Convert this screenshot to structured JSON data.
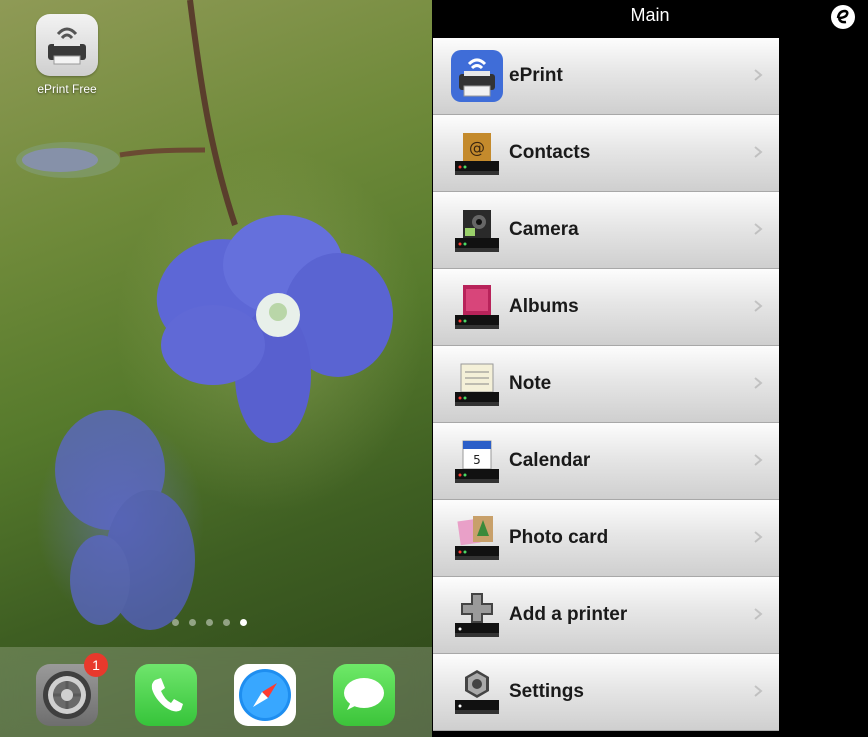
{
  "home_screen": {
    "app": {
      "label": "ePrint Free",
      "icon": "eprint-printer-icon"
    },
    "page_dots": {
      "count": 5,
      "active_index": 4
    },
    "dock": {
      "settings_badge": "1",
      "apps": [
        {
          "icon": "settings-gear-icon"
        },
        {
          "icon": "phone-icon"
        },
        {
          "icon": "safari-compass-icon"
        },
        {
          "icon": "messages-icon"
        }
      ]
    }
  },
  "eprint_app": {
    "nav": {
      "title": "Main",
      "logo_icon": "eprint-e-logo-icon"
    },
    "menu": [
      {
        "label": "ePrint",
        "icon": "eprint-wifi-printer-icon"
      },
      {
        "label": "Contacts",
        "icon": "contacts-printer-icon"
      },
      {
        "label": "Camera",
        "icon": "camera-printer-icon"
      },
      {
        "label": "Albums",
        "icon": "albums-printer-icon"
      },
      {
        "label": "Note",
        "icon": "note-printer-icon"
      },
      {
        "label": "Calendar",
        "icon": "calendar-printer-icon"
      },
      {
        "label": "Photo card",
        "icon": "photo-card-printer-icon"
      },
      {
        "label": "Add a printer",
        "icon": "add-printer-icon"
      },
      {
        "label": "Settings",
        "icon": "settings-printer-icon"
      }
    ]
  },
  "colors": {
    "badge": "#e8392c",
    "phone": "#4cd964",
    "messages": "#5fd85a"
  }
}
